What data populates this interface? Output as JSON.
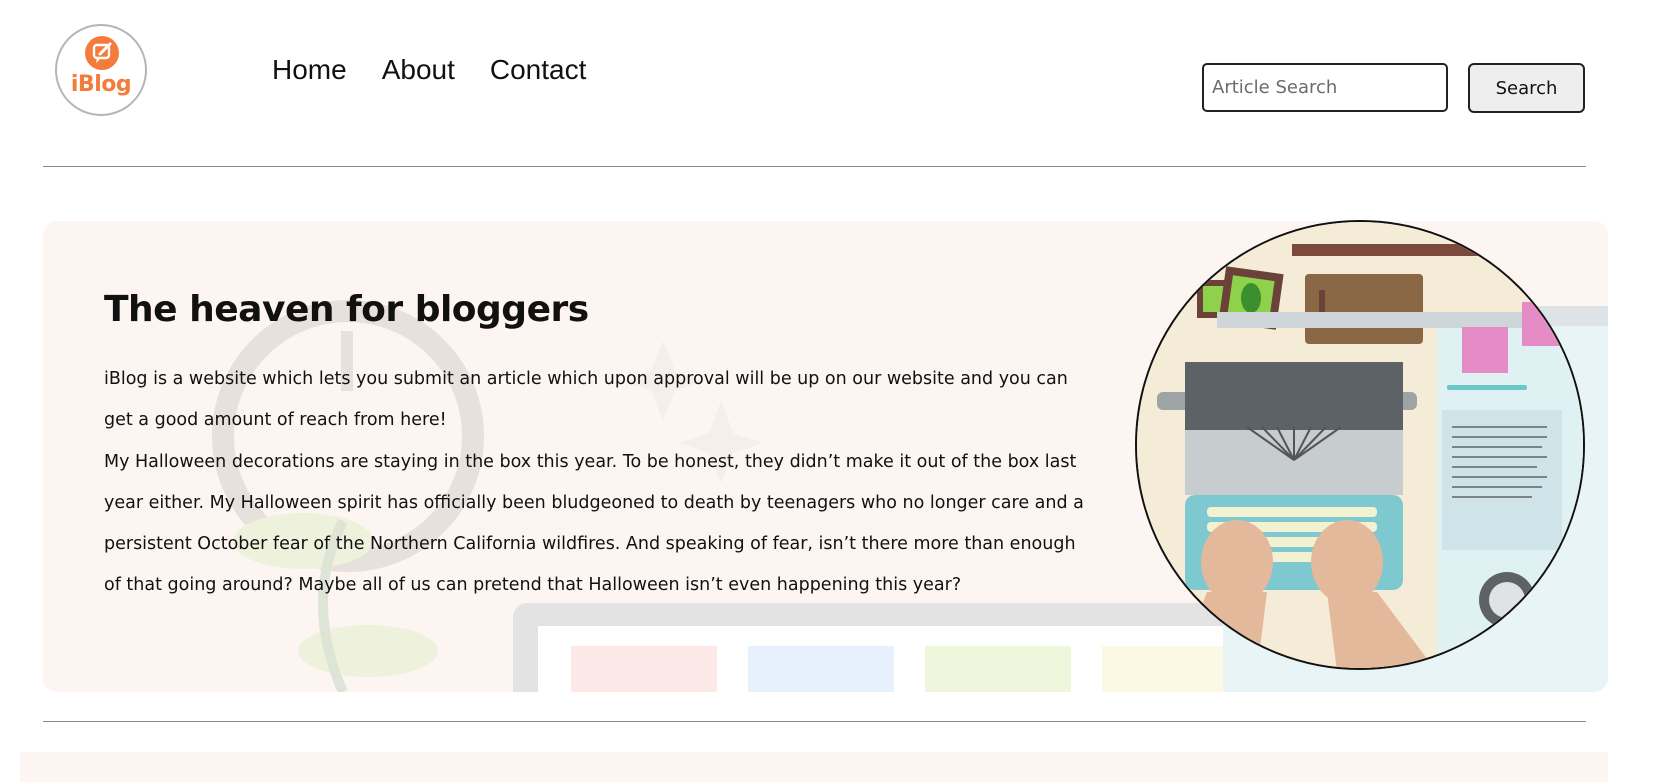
{
  "brand": {
    "logo_text": "iBlog",
    "accent": "#f47b3a"
  },
  "nav": {
    "items": [
      {
        "label": "Home"
      },
      {
        "label": "About"
      },
      {
        "label": "Contact"
      }
    ]
  },
  "search": {
    "placeholder": "Article Search",
    "value": "",
    "button_label": "Search"
  },
  "hero": {
    "title": "The heaven for bloggers",
    "paragraphs": [
      "iBlog is a website which lets you submit an article which upon approval will be up on our website and you can get a good amount of reach from here!",
      "My Halloween decorations are staying in the box this year. To be honest, they didn’t make it out of the box last year either. My Halloween spirit has officially been bludgeoned to death by teenagers who no longer care and a persistent October fear of the Northern California wildfires. And speaking of fear, isn’t there more than enough of that going around? Maybe all of us can pretend that Halloween isn’t even happening this year?"
    ],
    "background": "#fdf5f1"
  }
}
